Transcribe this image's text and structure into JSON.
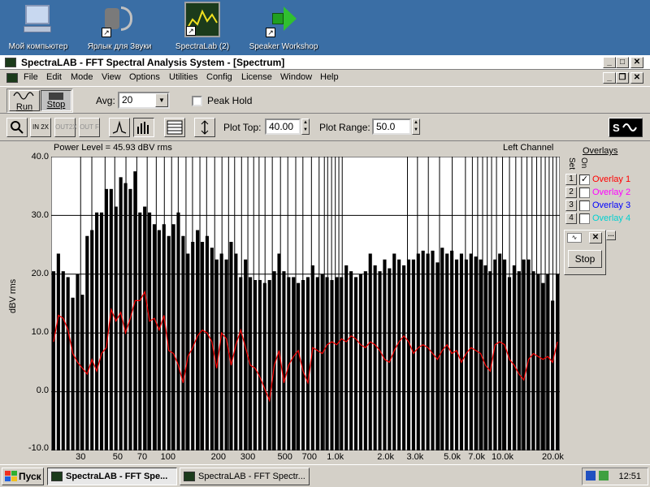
{
  "desktop": {
    "icons": [
      {
        "label": "Мой компьютер",
        "icon": "my-computer-icon"
      },
      {
        "label": "Ярлык для Звуки",
        "icon": "speaker-icon"
      },
      {
        "label": "SpectraLab (2)",
        "icon": "spectralab-icon"
      },
      {
        "label": "Speaker Workshop",
        "icon": "speaker-workshop-icon"
      }
    ]
  },
  "window": {
    "title": "SpectraLAB - FFT Spectral Analysis System - [Spectrum]",
    "menu": [
      "File",
      "Edit",
      "Mode",
      "View",
      "Options",
      "Utilities",
      "Config",
      "License",
      "Window",
      "Help"
    ]
  },
  "toolbar": {
    "run_label": "Run",
    "stop_label": "Stop",
    "avg_label": "Avg:",
    "avg_value": "20",
    "peak_hold_label": "Peak Hold",
    "peak_hold_checked": false,
    "plot_top_label": "Plot Top:",
    "plot_top_value": "40.00",
    "plot_range_label": "Plot Range:",
    "plot_range_value": "50.0",
    "icon_buttons": [
      "magnifier-icon",
      "zoom-in-2x-icon",
      "zoom-out-2x-icon",
      "zoom-out-full-icon",
      "line-mode-icon",
      "bar-mode-icon",
      "table-icon",
      "autoscale-icon",
      "signal-generator-icon"
    ]
  },
  "plot": {
    "power_level": "Power Level = 45.93 dBV rms",
    "channel": "Left Channel",
    "stop_button": "Stop"
  },
  "overlays": {
    "title": "Overlays",
    "set_label": "Set",
    "on_label": "On",
    "items": [
      {
        "num": "1",
        "label": "Overlay 1",
        "checked": true,
        "color": "#ff0000"
      },
      {
        "num": "2",
        "label": "Overlay 2",
        "checked": false,
        "color": "#ff00ff"
      },
      {
        "num": "3",
        "label": "Overlay 3",
        "checked": false,
        "color": "#0000ff"
      },
      {
        "num": "4",
        "label": "Overlay 4",
        "checked": false,
        "color": "#00d0d0"
      }
    ]
  },
  "chart_data": {
    "type": "bar",
    "ylabel": "dBV rms",
    "ylim": [
      -10,
      40
    ],
    "xscale": "log",
    "xlim": [
      20,
      22000
    ],
    "yticks": [
      "40.0",
      "30.0",
      "20.0",
      "10.0",
      "0.0",
      "-10.0"
    ],
    "xticks": [
      {
        "v": 30,
        "label": "30"
      },
      {
        "v": 50,
        "label": "50"
      },
      {
        "v": 70,
        "label": "70"
      },
      {
        "v": 100,
        "label": "100"
      },
      {
        "v": 200,
        "label": "200"
      },
      {
        "v": 300,
        "label": "300"
      },
      {
        "v": 500,
        "label": "500"
      },
      {
        "v": 700,
        "label": "700"
      },
      {
        "v": 1000,
        "label": "1.0k"
      },
      {
        "v": 2000,
        "label": "2.0k"
      },
      {
        "v": 3000,
        "label": "3.0k"
      },
      {
        "v": 5000,
        "label": "5.0k"
      },
      {
        "v": 7000,
        "label": "7.0k"
      },
      {
        "v": 10000,
        "label": "10.0k"
      },
      {
        "v": 20000,
        "label": "20.0k"
      }
    ],
    "series": [
      {
        "values": [
          20.5,
          23.5,
          20.5,
          19.5,
          16,
          20,
          16.5,
          26.5,
          27.5,
          30.5,
          30.5,
          34.5,
          34.5,
          31.5,
          36.5,
          35.5,
          34.5,
          37.5,
          30.5,
          31.5,
          30.5,
          28.5,
          27.5,
          28.5,
          26.5,
          28.5,
          30.5,
          26.5,
          23.5,
          25.5,
          27.5,
          25.5,
          26.5,
          24.5,
          22.5,
          23.5,
          22.5,
          25.5,
          23.5,
          19.5,
          22.5,
          19.5,
          19,
          19,
          18.5,
          19,
          20.5,
          23.5,
          20.5,
          19.5,
          19.5,
          18.5,
          19,
          19.5,
          21.5,
          19.5,
          20,
          19.5,
          19,
          19.5,
          19.5,
          21.5,
          20.5,
          19.5,
          20,
          20.5,
          23.5,
          21.5,
          20.5,
          22.5,
          21,
          23.5,
          22.5,
          21.5,
          22.5,
          22.5,
          23.5,
          24,
          23.5,
          24,
          22,
          24.5,
          23.5,
          24,
          22.5,
          23.5,
          22.5,
          23.5,
          23,
          22.5,
          21.5,
          20.5,
          22.5,
          23.5,
          22.5,
          19.5,
          21.5,
          20.5,
          22.5,
          22.5,
          20.5,
          20,
          18.5,
          20,
          15.5,
          20
        ]
      },
      {
        "name": "Overlay 1",
        "values": [
          8.5,
          13,
          12.5,
          10.5,
          6.5,
          5,
          4,
          3,
          5.5,
          3.5,
          6.5,
          7.5,
          14,
          12,
          13.5,
          10,
          12.5,
          15.5,
          15.5,
          17,
          12,
          12.5,
          10.5,
          13,
          7,
          6.5,
          4.5,
          1.5,
          6,
          7.5,
          9.5,
          10.5,
          10,
          8.5,
          4,
          10,
          9,
          4.5,
          8,
          10.5,
          7.5,
          4.5,
          4,
          2.5,
          0.5,
          -1.5,
          4.5,
          7,
          1.5,
          4.5,
          6,
          7,
          3.5,
          1.5,
          7.5,
          7,
          6.5,
          8,
          8.5,
          8,
          9,
          8.5,
          9.5,
          9,
          8,
          7.5,
          8.5,
          8,
          7,
          5.5,
          5,
          7,
          8.5,
          9.5,
          8.5,
          6.5,
          7.5,
          8,
          7.5,
          6.5,
          5.5,
          7,
          8,
          6.5,
          7,
          5,
          6.5,
          7.5,
          7,
          6.5,
          4.5,
          3.5,
          8,
          8.5,
          8,
          5.5,
          4.5,
          3,
          2,
          5.5,
          6.5,
          6,
          5.5,
          6,
          5,
          8.5
        ]
      }
    ],
    "peak_markers_hz": [
      30,
      35,
      42,
      48,
      56,
      65,
      75,
      85,
      95,
      105,
      115,
      128,
      140,
      155,
      170,
      190,
      210,
      230,
      250,
      275,
      300,
      325,
      350,
      380,
      420,
      470,
      520,
      580,
      640,
      720,
      800,
      860,
      900,
      950,
      1000,
      1050,
      1100,
      2700,
      3100,
      3600,
      4200,
      5000,
      6000,
      6600,
      7100,
      7600,
      8100,
      8600,
      9200,
      10000,
      11000,
      12000,
      13000,
      14000,
      15000,
      16000,
      17000,
      18000,
      19000,
      20000,
      21000
    ]
  },
  "taskbar": {
    "start_label": "Пуск",
    "tasks": [
      "SpectraLAB - FFT Spe...",
      "SpectraLAB - FFT Spectr..."
    ],
    "time": "12:51"
  }
}
